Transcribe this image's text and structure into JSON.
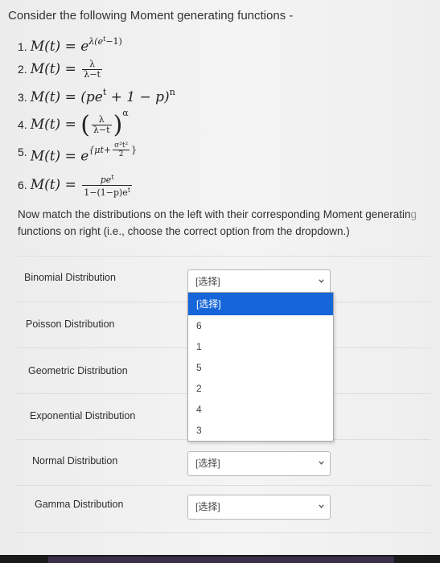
{
  "question": {
    "intro": "Consider the following Moment generating functions -",
    "formulas": {
      "f1": {
        "num": "1.",
        "lhs": "M(t) = e",
        "exp": "λ(e",
        "exp_sup": "t",
        "exp_tail": "−1)"
      },
      "f2": {
        "num": "2.",
        "lhs": "M(t) =",
        "n": "λ",
        "d": "λ−t"
      },
      "f3": {
        "num": "3.",
        "lhs": "M(t) = (pe",
        "sup": "t",
        "mid": " + 1 − p)",
        "pow": "n"
      },
      "f4": {
        "num": "4.",
        "lhs": "M(t) =",
        "n": "λ",
        "d": "λ−t",
        "pow": "α"
      },
      "f5": {
        "num": "5.",
        "lhs": "M(t) = e",
        "exp": "{μt+",
        "exp_n": "σ²t²",
        "exp_d": "2",
        "exp_tail": "}"
      },
      "f6": {
        "num": "6.",
        "lhs": "M(t) =",
        "n": "pe",
        "n_sup": "t",
        "d": "1−(1−p)e",
        "d_sup": "t"
      }
    },
    "instruction_main": "Now match the distributions on the left with their corresponding Moment generatin",
    "instruction_fade": "g",
    "instruction_line2": "functions on right (i.e., choose the correct option from the dropdown.)"
  },
  "rows": [
    {
      "label": "Binomial Distribution",
      "selected": "[选择]"
    },
    {
      "label": "Poisson Distribution"
    },
    {
      "label": "Geometric Distribution"
    },
    {
      "label": "Exponential Distribution"
    },
    {
      "label": "Normal Distribution",
      "selected": "[选择]"
    },
    {
      "label": "Gamma Distribution",
      "selected": "[选择]"
    }
  ],
  "dropdown": {
    "options": [
      "[选择]",
      "6",
      "1",
      "5",
      "2",
      "4",
      "3"
    ],
    "highlighted_index": 0
  },
  "colors": {
    "highlight": "#1666d9"
  },
  "icons": {
    "select_arrow": "chevron-down-icon"
  }
}
